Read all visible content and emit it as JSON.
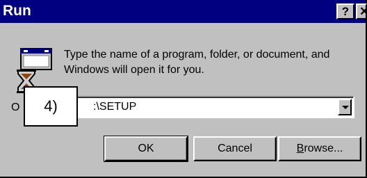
{
  "window": {
    "title": "Run",
    "help_label": "?",
    "close_label": "✕"
  },
  "message": "Type the name of a program, folder, or document, and Windows will open it for you.",
  "open": {
    "label_visible": "O",
    "value": ":\\SETUP"
  },
  "callout": "4)",
  "buttons": {
    "ok": "OK",
    "cancel": "Cancel",
    "browse_mnemonic": "B",
    "browse_rest": "rowse..."
  },
  "icons": {
    "program": "run-program-icon",
    "dropdown": "chevron-down-icon"
  },
  "colors": {
    "titlebar": "#000080",
    "face": "#c0c0c0"
  }
}
